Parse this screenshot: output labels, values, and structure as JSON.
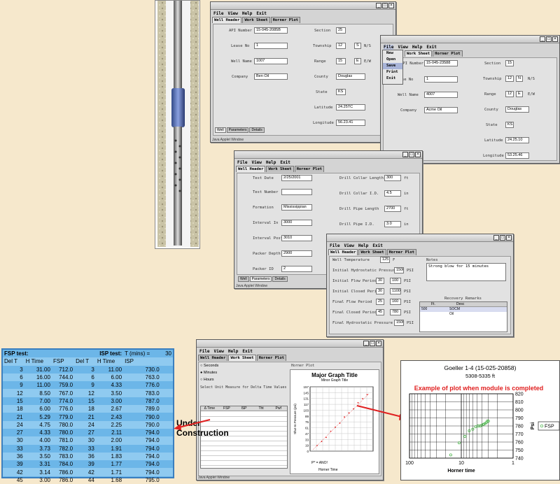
{
  "win1": {
    "menu": [
      "File",
      "View",
      "Help",
      "Exit"
    ],
    "tabs": [
      "Well Header",
      "Work Sheet",
      "Horner Plot"
    ],
    "left_fields": [
      {
        "label": "API Number",
        "value": "15-045-2085B"
      },
      {
        "label": "Lease No",
        "value": "1"
      },
      {
        "label": "Well Name",
        "value": "1007"
      },
      {
        "label": "Company",
        "value": "Ben Oil"
      }
    ],
    "right_fields": [
      {
        "label": "Section",
        "value": "25"
      },
      {
        "label": "Township",
        "value": "12",
        "value2": "S",
        "unit": "N/S"
      },
      {
        "label": "Range",
        "value": "15",
        "value2": "E",
        "unit": "E/W"
      },
      {
        "label": "County",
        "value": "Douglas"
      },
      {
        "label": "State",
        "value": "KS"
      },
      {
        "label": "Latitude",
        "value": "24.25TC"
      },
      {
        "label": "Longitude",
        "value": "56.23.41"
      }
    ],
    "bottom_tabs": [
      "Well",
      "Parameters",
      "Details"
    ],
    "status": "Java Applet Window"
  },
  "win2": {
    "menu": [
      "File",
      "View",
      "Help",
      "Exit"
    ],
    "tabs": [
      "Work Sheet",
      "Horner Plot"
    ],
    "file_menu_items": [
      "New",
      "Open",
      "Save",
      "Print",
      "Exit"
    ],
    "left_fields": [
      {
        "label": "API Number",
        "value": "15-045-23588"
      },
      {
        "label": "Lease No",
        "value": "1"
      },
      {
        "label": "Well Name",
        "value": "4007"
      },
      {
        "label": "Company",
        "value": "Acme Oil"
      }
    ],
    "right_fields": [
      {
        "label": "Section",
        "value": "15"
      },
      {
        "label": "Township",
        "value": "12",
        "value2": "N",
        "unit": "N/S"
      },
      {
        "label": "Range",
        "value": "12",
        "value2": "E",
        "unit": "E/W"
      },
      {
        "label": "County",
        "value": "Douglas"
      },
      {
        "label": "State",
        "value": "KS"
      },
      {
        "label": "Latitude",
        "value": "24.25.10"
      },
      {
        "label": "Longitude",
        "value": "53.25.46"
      }
    ]
  },
  "win3": {
    "menu": [
      "File",
      "View",
      "Help",
      "Exit"
    ],
    "tabs": [
      "Well Header",
      "Work Sheet",
      "Horner Plot"
    ],
    "left_fields": [
      {
        "label": "Test Date",
        "value": "2/25/2001"
      },
      {
        "label": "Test Number",
        "value": ""
      },
      {
        "label": "Formation",
        "value": "Mississippian"
      },
      {
        "label": "Interval In",
        "value": "3000"
      },
      {
        "label": "Interval Post",
        "value": "3010"
      },
      {
        "label": "Packer Depth",
        "value": "2900"
      },
      {
        "label": "Packer ID",
        "value": "2"
      }
    ],
    "right_fields": [
      {
        "label": "Drill Collar Length",
        "value": "300",
        "unit": "ft"
      },
      {
        "label": "Drill Collar I.D.",
        "value": "4.5",
        "unit": "in"
      },
      {
        "label": "Drill Pipe Length",
        "value": "2700",
        "unit": "ft"
      },
      {
        "label": "Drill Pipe I.D.",
        "value": "3.0",
        "unit": "in"
      }
    ],
    "bottom_tabs": [
      "Well",
      "Parameters",
      "Details"
    ],
    "status": "Java Applet Window"
  },
  "win4": {
    "menu": [
      "File",
      "View",
      "Help",
      "Exit"
    ],
    "tabs": [
      "Well Header",
      "Work Sheet",
      "Horner Plot"
    ],
    "fields": [
      {
        "label": "Well Temperature",
        "value": "125",
        "unit": "F"
      },
      {
        "label": "Initial Hydrostatic Pressure",
        "value": "1500",
        "unit": "PSI"
      },
      {
        "label": "Initial Flow Period",
        "value": "30",
        "value2": "100",
        "unit": "PSI"
      },
      {
        "label": "Initial Closed Period",
        "value": "30",
        "value2": "1100",
        "unit": "PSI"
      },
      {
        "label": "Final Flow Period",
        "value": "25",
        "value2": "160",
        "unit": "PSI"
      },
      {
        "label": "Final Closed Period",
        "value": "45",
        "value2": "780",
        "unit": "PSI"
      },
      {
        "label": "Final Hydrostatic Pressure",
        "value": "1500",
        "unit": "PSI"
      }
    ],
    "notes_label": "Notes",
    "notes_text": "Strong blow for 15 minutes",
    "recovery_label": "Recovery Remarks",
    "recovery_cols": [
      "Ft.",
      "Desc"
    ],
    "recovery_rows": [
      [
        "500",
        "SOCM"
      ],
      [
        "",
        "Oil"
      ]
    ]
  },
  "win5": {
    "menu": [
      "File",
      "View",
      "Help",
      "Exit"
    ],
    "tabs": [
      "Well Header",
      "Work Sheet",
      "Horner Plot"
    ],
    "radios": [
      "Seconds",
      "Minutes",
      "Hours"
    ],
    "instruction": "Select Unit Measure for Delta Time Values",
    "grid_cols": [
      "Δ Time",
      "FSP",
      "ISP",
      "Tht",
      "Pwf"
    ],
    "horner_plot_label": "Horner Plot",
    "graph_title": "Major Graph Title",
    "graph_subtitle": "Minor Graph Title",
    "graph_ylabel": "Shut-In Pressure (psi)",
    "graph_yticks": [
      "157",
      "145",
      "131",
      "117",
      "103",
      "89",
      "75",
      "61",
      "47",
      "33",
      "19",
      "0"
    ],
    "graph_xlabel": "Horner Time",
    "pstar": "P* = ANO!",
    "status": "Java Applet Window"
  },
  "fsp_table": {
    "fsp_title": "FSP test:",
    "isp_title": "ISP test:",
    "t_label": "T (mins) =",
    "t_value": "30",
    "columns": [
      "Del T",
      "H Time",
      "FSP",
      "Del T",
      "H Time",
      "ISP"
    ],
    "rows": [
      [
        "3",
        "31.00",
        "712.0",
        "3",
        "11.00",
        "730.0"
      ],
      [
        "6",
        "16.00",
        "744.0",
        "6",
        "6.00",
        "763.0"
      ],
      [
        "9",
        "11.00",
        "759.0",
        "9",
        "4.33",
        "776.0"
      ],
      [
        "12",
        "8.50",
        "767.0",
        "12",
        "3.50",
        "783.0"
      ],
      [
        "15",
        "7.00",
        "774.0",
        "15",
        "3.00",
        "787.0"
      ],
      [
        "18",
        "6.00",
        "776.0",
        "18",
        "2.67",
        "789.0"
      ],
      [
        "21",
        "5.29",
        "779.0",
        "21",
        "2.43",
        "790.0"
      ],
      [
        "24",
        "4.75",
        "780.0",
        "24",
        "2.25",
        "790.0"
      ],
      [
        "27",
        "4.33",
        "780.0",
        "27",
        "2.11",
        "794.0"
      ],
      [
        "30",
        "4.00",
        "781.0",
        "30",
        "2.00",
        "794.0"
      ],
      [
        "33",
        "3.73",
        "782.0",
        "33",
        "1.91",
        "794.0"
      ],
      [
        "36",
        "3.50",
        "783.0",
        "36",
        "1.83",
        "794.0"
      ],
      [
        "39",
        "3.31",
        "784.0",
        "39",
        "1.77",
        "794.0"
      ],
      [
        "42",
        "3.14",
        "786.0",
        "42",
        "1.71",
        "794.0"
      ],
      [
        "45",
        "3.00",
        "786.0",
        "44",
        "1.68",
        "795.0"
      ]
    ]
  },
  "under_construction": "Under Construction",
  "chart_data": {
    "type": "scatter",
    "title": "Goeller 1-4 (15-025-20858)",
    "subtitle": "5308-5335 ft",
    "annotation": "Example of plot when module is completed",
    "xlabel": "Horner time",
    "ylabel": "Psi",
    "x_scale": "log",
    "x_reversed": true,
    "xlim": [
      100,
      1
    ],
    "ylim": [
      740,
      820
    ],
    "xticks": [
      "100",
      "10",
      "1"
    ],
    "yticks": [
      "820",
      "810",
      "800",
      "790",
      "780",
      "770",
      "760",
      "750",
      "740"
    ],
    "legend": "right",
    "series": [
      {
        "name": "FSP",
        "color": "#33aa33",
        "x": [
          31.0,
          16.0,
          11.0,
          8.5,
          7.0,
          6.0,
          5.29,
          4.75,
          4.33,
          4.0,
          3.73,
          3.5,
          3.31,
          3.14,
          3.0
        ],
        "y": [
          712.0,
          744.0,
          759.0,
          767.0,
          774.0,
          776.0,
          779.0,
          780.0,
          780.0,
          781.0,
          782.0,
          783.0,
          784.0,
          786.0,
          786.0
        ]
      }
    ]
  },
  "colors": {
    "accent_red": "#e02020",
    "table_bg": "#6cb6e8"
  }
}
